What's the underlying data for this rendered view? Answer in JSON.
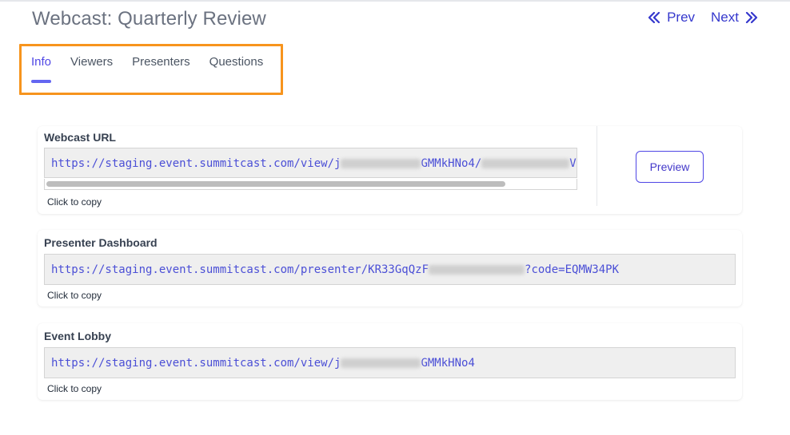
{
  "header": {
    "title": "Webcast: Quarterly Review",
    "prev_label": "Prev",
    "next_label": "Next"
  },
  "tabs": [
    {
      "label": "Info",
      "active": true
    },
    {
      "label": "Viewers",
      "active": false
    },
    {
      "label": "Presenters",
      "active": false
    },
    {
      "label": "Questions",
      "active": false
    }
  ],
  "webcast_url": {
    "label": "Webcast URL",
    "value_prefix": "https://staging.event.summitcast.com/view/j",
    "value_middle": "GMMkHNo4/",
    "value_suffix": "V",
    "copy_hint": "Click to copy",
    "preview_label": "Preview"
  },
  "presenter_dashboard": {
    "label": "Presenter Dashboard",
    "value_prefix": "https://staging.event.summitcast.com/presenter/KR33GqQzF",
    "value_suffix": "?code=EQMW34PK",
    "copy_hint": "Click to copy"
  },
  "event_lobby": {
    "label": "Event Lobby",
    "value_prefix": "https://staging.event.summitcast.com/view/j",
    "value_suffix": "GMMkHNo4",
    "copy_hint": "Click to copy"
  },
  "colors": {
    "accent": "#4f46e5",
    "link": "#3538cd",
    "highlight_border": "#f7941d",
    "url_text": "#4b4fd6"
  },
  "icons": {
    "prev": "double-chevron-left-icon",
    "next": "double-chevron-right-icon"
  }
}
